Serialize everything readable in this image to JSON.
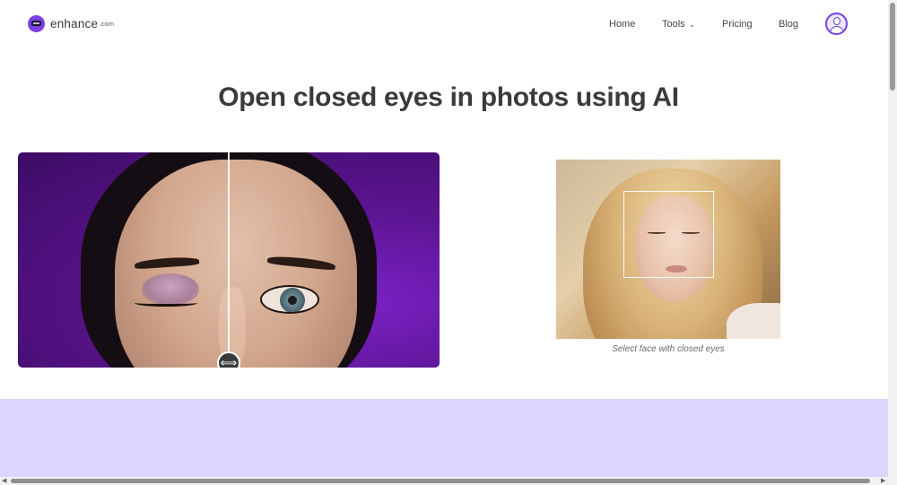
{
  "header": {
    "logo_text": "enhance",
    "logo_suffix": ".com",
    "nav": {
      "home": "Home",
      "tools": "Tools",
      "pricing": "Pricing",
      "blog": "Blog"
    },
    "tools_chevron": "⌄"
  },
  "hero": {
    "title": "Open closed eyes in photos using AI"
  },
  "compare": {
    "handle_glyph": "⟺"
  },
  "sample": {
    "caption": "Select face with closed eyes"
  },
  "colors": {
    "brand": "#7b3fe4",
    "band": "#dcd5fd",
    "compare_bg": "#5b148f"
  },
  "icons": [
    "logo-icon",
    "chevron-down-icon",
    "user-avatar-icon",
    "drag-arrows-icon"
  ]
}
